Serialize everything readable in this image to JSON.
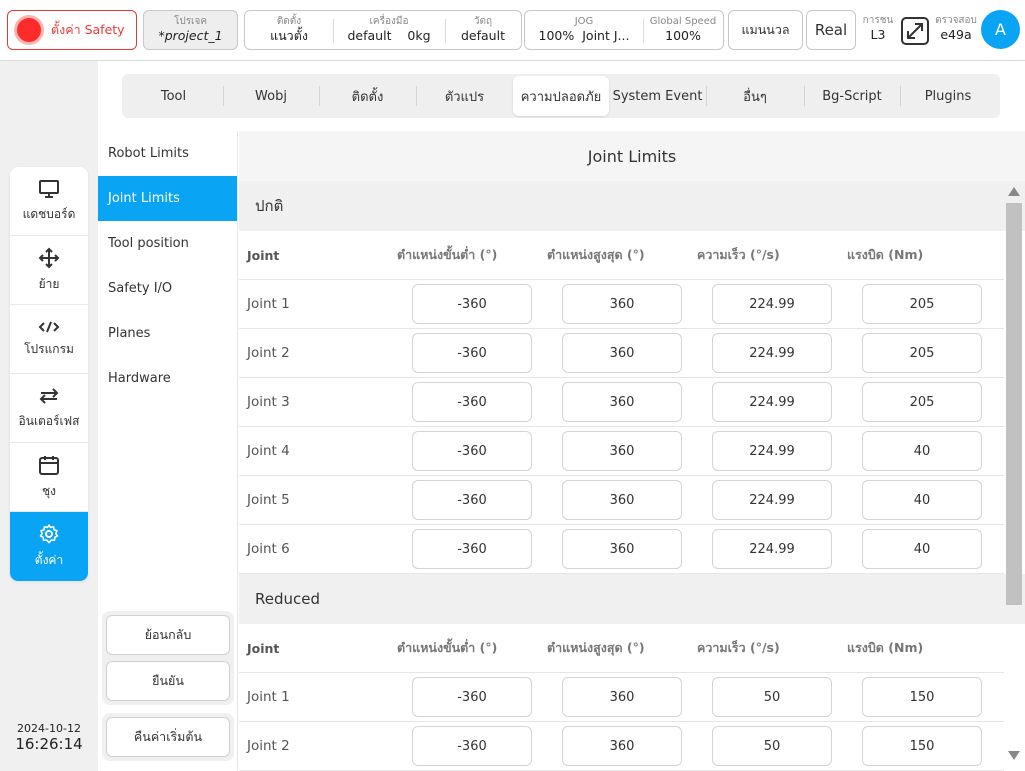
{
  "topbar": {
    "safety_label": "ตั้งค่า Safety",
    "project": {
      "label": "โปรเจค",
      "value": "*project_1"
    },
    "install": {
      "label": "ติดตั้ง",
      "value": "แนวตั้ง"
    },
    "tool": {
      "label": "เครื่องมือ",
      "value": "default",
      "load": "0kg"
    },
    "wobj": {
      "label": "วัตถุ",
      "value": "default"
    },
    "jog": {
      "label": "JOG",
      "value": "100%",
      "joint": "Joint J..."
    },
    "global_speed": {
      "label": "Global Speed",
      "value": "100%"
    },
    "mode": "แมนนวล",
    "real": "Real",
    "collision": {
      "label": "การชน",
      "value": "L3"
    },
    "check": {
      "label": "ตรวจสอบ",
      "value": "e49a"
    },
    "avatar": "A"
  },
  "leftnav": [
    {
      "label": "แดชบอร์ด",
      "icon": "monitor-icon"
    },
    {
      "label": "ย้าย",
      "icon": "move-icon"
    },
    {
      "label": "โปรแกรม",
      "icon": "code-icon"
    },
    {
      "label": "อินเตอร์เฟส",
      "icon": "swap-icon"
    },
    {
      "label": "ชุง",
      "icon": "calendar-icon"
    },
    {
      "label": "ตั้งค่า",
      "icon": "gear-icon"
    }
  ],
  "datetime": {
    "date": "2024-10-12",
    "time": "16:26:14"
  },
  "tabs": [
    "Tool",
    "Wobj",
    "ติดตั้ง",
    "ตัวแปร",
    "ความปลอดภัย",
    "System Event",
    "อื่นๆ",
    "Bg-Script",
    "Plugins"
  ],
  "subnav": [
    "Robot Limits",
    "Joint Limits",
    "Tool position",
    "Safety I/O",
    "Planes",
    "Hardware"
  ],
  "actions": {
    "back": "ย้อนกลับ",
    "confirm": "ยืนยัน",
    "reset": "คืนค่าเริ่มต้น"
  },
  "content": {
    "title": "Joint Limits",
    "headers": [
      "Joint",
      "ตำแหน่งขั้นต่ำ (°)",
      "ตำแหน่งสูงสุด (°)",
      "ความเร็ว (°/s)",
      "แรงบิด (Nm)"
    ],
    "normal": {
      "title": "ปกติ",
      "rows": [
        {
          "joint": "Joint 1",
          "min": "-360",
          "max": "360",
          "speed": "224.99",
          "torque": "205"
        },
        {
          "joint": "Joint 2",
          "min": "-360",
          "max": "360",
          "speed": "224.99",
          "torque": "205"
        },
        {
          "joint": "Joint 3",
          "min": "-360",
          "max": "360",
          "speed": "224.99",
          "torque": "205"
        },
        {
          "joint": "Joint 4",
          "min": "-360",
          "max": "360",
          "speed": "224.99",
          "torque": "40"
        },
        {
          "joint": "Joint 5",
          "min": "-360",
          "max": "360",
          "speed": "224.99",
          "torque": "40"
        },
        {
          "joint": "Joint 6",
          "min": "-360",
          "max": "360",
          "speed": "224.99",
          "torque": "40"
        }
      ]
    },
    "reduced": {
      "title": "Reduced",
      "rows": [
        {
          "joint": "Joint 1",
          "min": "-360",
          "max": "360",
          "speed": "50",
          "torque": "150"
        },
        {
          "joint": "Joint 2",
          "min": "-360",
          "max": "360",
          "speed": "50",
          "torque": "150"
        }
      ]
    }
  },
  "colors": {
    "accent": "#0aa4f5",
    "safety": "#e53935"
  }
}
